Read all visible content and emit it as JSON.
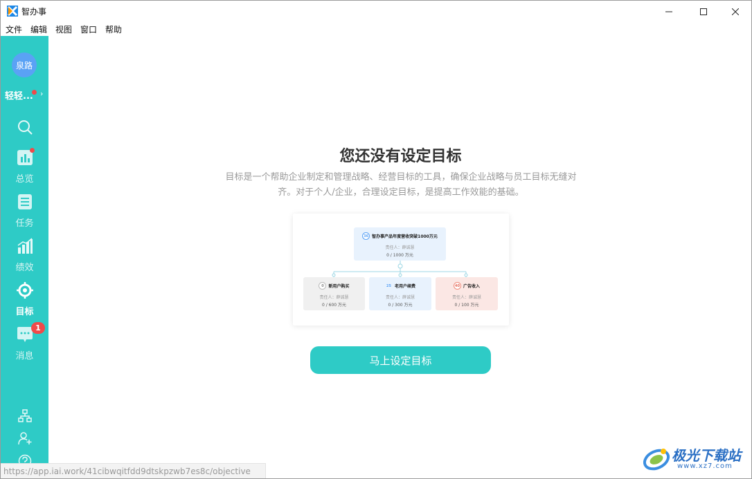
{
  "window": {
    "title": "智办事"
  },
  "menu": [
    "文件",
    "编辑",
    "视图",
    "窗口",
    "帮助"
  ],
  "sidebar": {
    "avatar_text": "泉路",
    "org_name": "轻轻...",
    "nav": [
      {
        "label": "",
        "icon": "search-icon"
      },
      {
        "label": "总览",
        "icon": "overview-chart-icon",
        "dot": true
      },
      {
        "label": "任务",
        "icon": "task-list-icon"
      },
      {
        "label": "绩效",
        "icon": "performance-bar-icon"
      },
      {
        "label": "目标",
        "icon": "target-icon",
        "active": true
      },
      {
        "label": "消息",
        "icon": "message-bubble-icon",
        "badge": "1"
      }
    ],
    "bottom_icons": [
      "org-structure-icon",
      "add-member-icon",
      "help-icon"
    ]
  },
  "main": {
    "title": "您还没有设定目标",
    "description": "目标是一个帮助企业制定和管理战略、经营目标的工具，确保企业战略与员工目标无缝对齐。对于个人/企业，合理设定目标，是提高工作效能的基础。",
    "illustration": {
      "top": {
        "progress": "36",
        "title": "智办事产品年度营收突破1000万元",
        "owner": "责任人：薛诚慧",
        "value": "0 / 1000 万元"
      },
      "children": [
        {
          "progress": "0",
          "title": "新用户购买",
          "owner": "责任人：薛诚慧",
          "value": "0 / 600 万元",
          "color": "#f0f0f0"
        },
        {
          "progress": "25",
          "title": "老用户续费",
          "owner": "责任人：薛诚慧",
          "value": "0 / 300 万元",
          "color": "#e8f2fd"
        },
        {
          "progress": "40",
          "title": "广告收入",
          "owner": "责任人：薛诚慧",
          "value": "0 / 100 万元",
          "color": "#fbe7e4"
        }
      ]
    },
    "cta_label": "马上设定目标"
  },
  "status_url": "https://app.iai.work/41cibwqitfdd9dtskpzwb7es8c/objective",
  "watermark": {
    "text": "极光下载站",
    "url": "www.xz7.com"
  },
  "colors": {
    "accent": "#2ecbc6",
    "badge": "#f04a4a",
    "avatar": "#5aa2f5"
  }
}
